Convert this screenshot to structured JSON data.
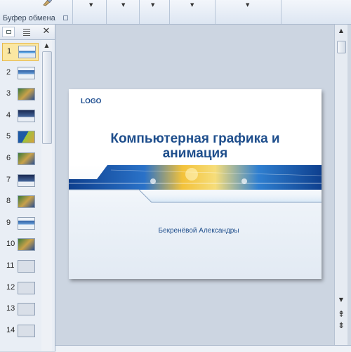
{
  "ribbon": {
    "clipboard_label": "Буфер обмена",
    "dropdown_arrow": "▼"
  },
  "side_panel": {
    "close_glyph": "✕",
    "slides": [
      {
        "num": "1",
        "thumb": "title"
      },
      {
        "num": "2",
        "thumb": "blue"
      },
      {
        "num": "3",
        "thumb": "photo"
      },
      {
        "num": "4",
        "thumb": "dark"
      },
      {
        "num": "5",
        "thumb": "green"
      },
      {
        "num": "6",
        "thumb": "photo"
      },
      {
        "num": "7",
        "thumb": "dark"
      },
      {
        "num": "8",
        "thumb": "photo"
      },
      {
        "num": "9",
        "thumb": "blue"
      },
      {
        "num": "10",
        "thumb": "photo"
      },
      {
        "num": "11",
        "thumb": "empty"
      },
      {
        "num": "12",
        "thumb": "empty"
      },
      {
        "num": "13",
        "thumb": "empty"
      },
      {
        "num": "14",
        "thumb": "empty"
      }
    ],
    "selected_slide": "1"
  },
  "slide": {
    "logo": "LOGO",
    "title_line1": "Компьютерная графика и",
    "title_line2": "анимация",
    "author": "Бекренёвой Александры"
  },
  "scrollbar": {
    "up": "▲",
    "down": "▼",
    "prev_slide": "⇞",
    "next_slide": "⇟"
  },
  "colors": {
    "title": "#1e4e8c",
    "band_blue": "#1a55a8",
    "band_yellow": "#f3c23a",
    "selection": "#fbe7a2"
  }
}
